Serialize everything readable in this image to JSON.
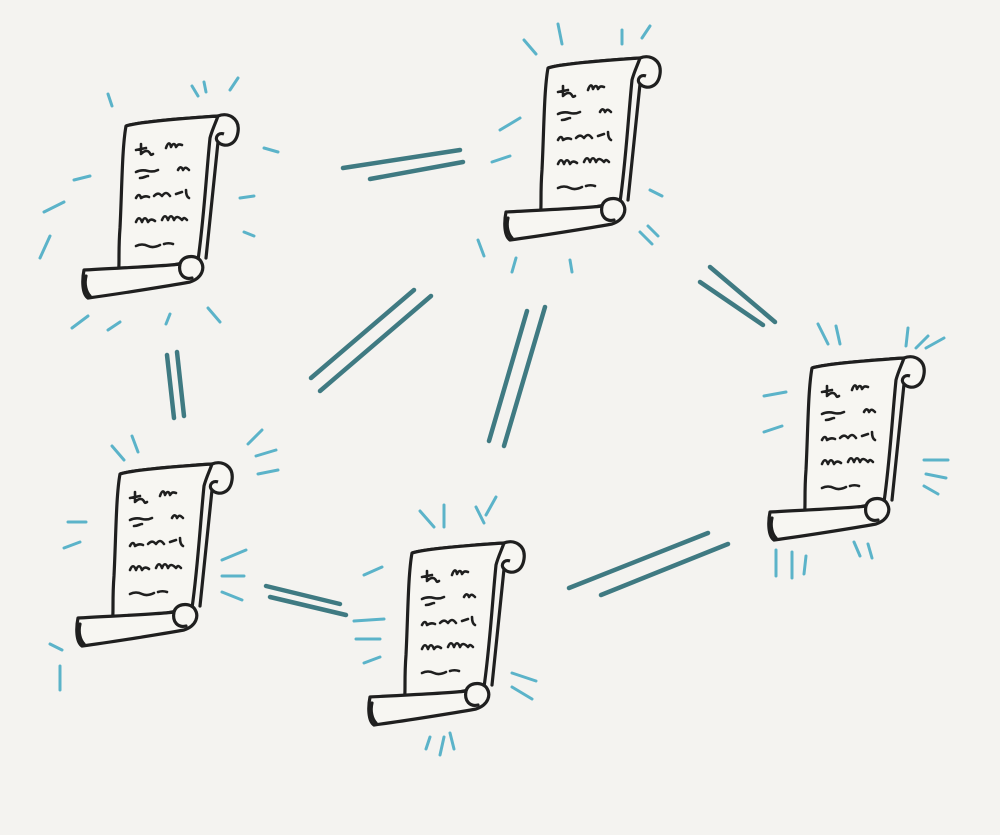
{
  "diagram": {
    "colors": {
      "background": "#f4f3f0",
      "link": "#3f7a82",
      "glow": "#5bb3c9",
      "ink": "#1f1f1f",
      "paper": "#f7f6f2"
    },
    "nodes": [
      {
        "id": "scroll-1",
        "icon": "scroll-icon"
      },
      {
        "id": "scroll-2",
        "icon": "scroll-icon"
      },
      {
        "id": "scroll-3",
        "icon": "scroll-icon"
      },
      {
        "id": "scroll-4",
        "icon": "scroll-icon"
      },
      {
        "id": "scroll-5",
        "icon": "scroll-icon"
      },
      {
        "id": "scroll-6",
        "icon": "scroll-icon"
      }
    ],
    "edges": [
      {
        "from": "scroll-1",
        "to": "scroll-2"
      },
      {
        "from": "scroll-1",
        "to": "scroll-3"
      },
      {
        "from": "scroll-2",
        "to": "scroll-4"
      },
      {
        "from": "scroll-2",
        "to": "scroll-5"
      },
      {
        "from": "scroll-2",
        "to": "scroll-6"
      },
      {
        "from": "scroll-3",
        "to": "scroll-5"
      },
      {
        "from": "scroll-5",
        "to": "scroll-6"
      }
    ]
  }
}
